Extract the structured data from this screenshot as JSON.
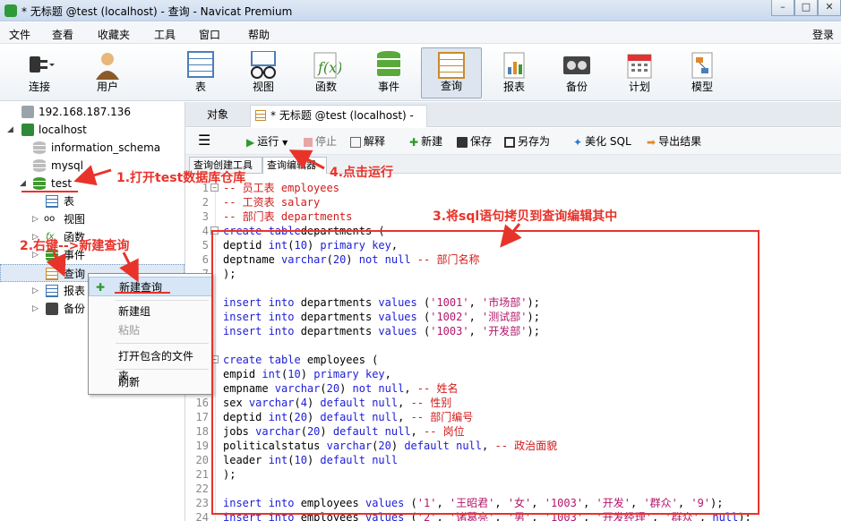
{
  "window": {
    "title": "* 无标题 @test (localhost) - 查询 - Navicat Premium"
  },
  "menubar": {
    "items": [
      "文件",
      "查看",
      "收藏夹",
      "工具",
      "窗口",
      "帮助"
    ],
    "login": "登录"
  },
  "toolbar": {
    "connect": "连接",
    "user": "用户",
    "table": "表",
    "view": "视图",
    "function": "函数",
    "event": "事件",
    "query": "查询",
    "report": "报表",
    "backup": "备份",
    "schedule": "计划",
    "model": "模型"
  },
  "tree": {
    "host": "192.168.187.136",
    "localhost": "localhost",
    "db_info": "information_schema",
    "db_mysql": "mysql",
    "db_test": "test",
    "table": "表",
    "view": "视图",
    "function": "函数",
    "event": "事件",
    "query": "查询",
    "report": "报表",
    "backup": "备份"
  },
  "context_menu": {
    "new_query": "新建查询",
    "new_group": "新建组",
    "paste": "粘贴",
    "open_folder": "打开包含的文件夹...",
    "refresh": "刷新"
  },
  "tabs": {
    "objects": "对象",
    "query_tab": "* 无标题 @test (localhost) - ..."
  },
  "query_toolbar": {
    "run": "运行",
    "stop": "停止",
    "explain": "解释",
    "new": "新建",
    "save": "保存",
    "save_as": "另存为",
    "beautify": "美化 SQL",
    "export": "导出结果"
  },
  "subtabs": {
    "builder": "查询创建工具",
    "editor": "查询编辑器"
  },
  "annotations": {
    "step1": "1.打开test数据库仓库",
    "step2": "2.右键-->新建查询",
    "step3": "3.将sql语句拷贝到查询编辑其中",
    "step4": "4.点击运行"
  },
  "editor": {
    "line_numbers": [
      "1",
      "2",
      "3",
      "4",
      "5",
      "6",
      "7",
      "8",
      "9",
      "10",
      "11",
      "12",
      "13",
      "14",
      "15",
      "16",
      "17",
      "18",
      "19",
      "20",
      "21",
      "22",
      "23",
      "24"
    ]
  },
  "colors": {
    "annotation": "#e8332a",
    "keyword": "#1c1cd6",
    "comment": "#d11a1a",
    "string": "#b3166a"
  }
}
